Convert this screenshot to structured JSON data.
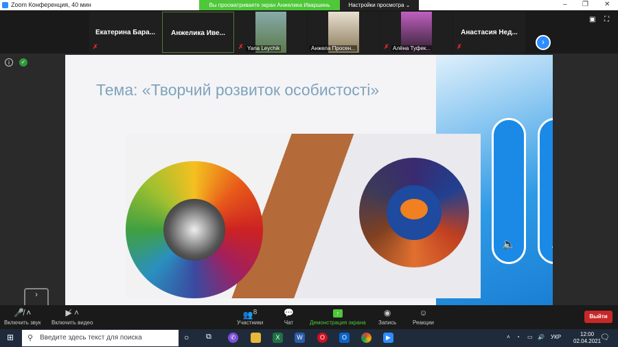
{
  "window": {
    "title": "Zoom Конференция, 40 мин",
    "share_banner": "Вы просматриваете экран Анжелика Иваршинь",
    "view_settings": "Настройки просмотра ⌄"
  },
  "participants": [
    {
      "name": "Екатерина  Бара..."
    },
    {
      "name": "Анжелика  Иве..."
    },
    {
      "name": "Yana Leychik"
    },
    {
      "name": "Анжела Просен..."
    },
    {
      "name": "Алёна Туфек..."
    },
    {
      "name": "Анастасия  Нед..."
    }
  ],
  "slide": {
    "title": "Тема: «Творчий розвиток особистості»"
  },
  "toolbar": {
    "audio": "Включить звук",
    "video": "Включить видео",
    "participants": "Участники",
    "participants_count": "8",
    "chat": "Чат",
    "share": "Демонстрация экрана",
    "record": "Запись",
    "reactions": "Реакции",
    "leave": "Выйти"
  },
  "taskbar": {
    "search_placeholder": "Введите здесь текст для поиска",
    "lang": "УКР",
    "time": "12:00",
    "date": "02.04.2021"
  },
  "colors": {
    "zoom_blue": "#2d8cff",
    "share_green": "#4ec739",
    "leave_red": "#c82828"
  }
}
